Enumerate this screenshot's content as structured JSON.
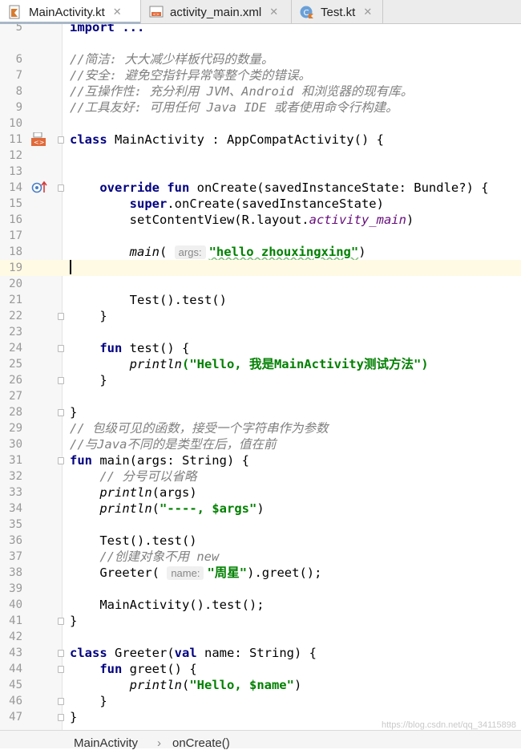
{
  "tabs": [
    {
      "label": "MainActivity.kt",
      "icon": "kotlin-file-icon",
      "active": true
    },
    {
      "label": "activity_main.xml",
      "icon": "layout-xml-icon",
      "active": false
    },
    {
      "label": "Test.kt",
      "icon": "kotlin-class-icon",
      "active": false
    }
  ],
  "tab_close_glyph": "✕",
  "line_numbers": [
    "5",
    "6",
    "7",
    "8",
    "9",
    "10",
    "11",
    "12",
    "13",
    "14",
    "15",
    "16",
    "17",
    "18",
    "19",
    "20",
    "21",
    "22",
    "23",
    "24",
    "25",
    "26",
    "27",
    "28",
    "29",
    "30",
    "31",
    "32",
    "33",
    "34",
    "35",
    "36",
    "37",
    "38",
    "39",
    "40",
    "41",
    "42",
    "43",
    "44",
    "45",
    "46",
    "47"
  ],
  "code": {
    "l5": "import ...",
    "l6": "//简洁: 大大减少样板代码的数量。",
    "l7": "//安全: 避免空指针异常等整个类的错误。",
    "l8": "//互操作性: 充分利用 JVM、Android 和浏览器的现有库。",
    "l9": "//工具友好: 可用任何 Java IDE 或者使用命令行构建。",
    "l11_kw": "class",
    "l11_rest": " MainActivity : AppCompatActivity() {",
    "l14_kw": "override fun",
    "l14_rest": " onCreate(savedInstanceState: Bundle?) {",
    "l15_kw": "super",
    "l15_rest": ".onCreate(savedInstanceState)",
    "l16_a": "setContentView(R.layout.",
    "l16_b": "activity_main",
    "l16_c": ")",
    "l18_fn": "main",
    "l18_open": "( ",
    "l18_hint": "args:",
    "l18_str": "\"hello zhouxingxing\"",
    "l18_close": ")",
    "l21": "Test().test()",
    "l22": "}",
    "l24_kw": "fun",
    "l24_rest": " test() {",
    "l25_fn": "println",
    "l25_str": "(\"Hello, 我是MainActivity测试方法\")",
    "l26": "}",
    "l28": "}",
    "l29": "// 包级可见的函数，接受一个字符串作为参数",
    "l30": "//与Java不同的是类型在后，值在前",
    "l31_kw": "fun",
    "l31_rest": " main(args: String) {",
    "l32": "// 分号可以省略",
    "l33_fn": "println",
    "l33_rest": "(args)",
    "l34_fn": "println",
    "l34_open": "(",
    "l34_str": "\"----, ",
    "l34_tmpl": "$args",
    "l34_str2": "\"",
    "l34_close": ")",
    "l36": "Test().test()",
    "l37_cm": "//创建对象不用 ",
    "l37_it": "new",
    "l38_a": "Greeter( ",
    "l38_hint": "name:",
    "l38_str": "\"周星\"",
    "l38_b": ").greet();",
    "l40": "MainActivity().test();",
    "l41": "}",
    "l43_kw": "class",
    "l43_a": " Greeter(",
    "l43_kw2": "val",
    "l43_b": " name: String) {",
    "l44_kw": "fun",
    "l44_rest": " greet() {",
    "l45_fn": "println",
    "l45_open": "(",
    "l45_str": "\"Hello, ",
    "l45_tmpl": "$name",
    "l45_str2": "\"",
    "l45_close": ")",
    "l46": "}",
    "l47": "}"
  },
  "breadcrumb": {
    "class": "MainActivity",
    "sep": "›",
    "method": "onCreate()"
  },
  "watermark": "https://blog.csdn.net/qq_34115898",
  "colors": {
    "keyword": "#000080",
    "string": "#008000",
    "comment": "#808080",
    "current_line": "#fffae3"
  }
}
